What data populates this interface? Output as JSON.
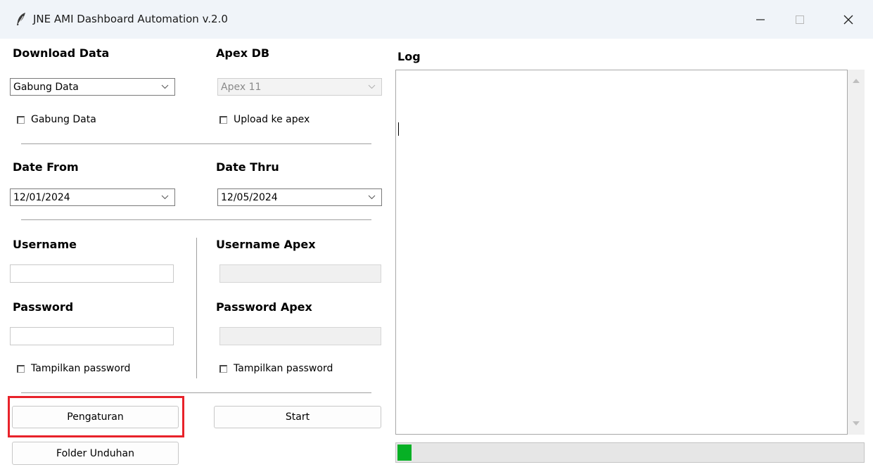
{
  "window": {
    "title": "JNE AMI Dashboard Automation v.2.0",
    "app_icon": "feather-icon",
    "controls": [
      "minimize-icon",
      "maximize-icon",
      "close-icon"
    ]
  },
  "download": {
    "label": "Download Data",
    "selected": "Gabung Data",
    "checkbox_label": "Gabung Data",
    "checked": false
  },
  "apex": {
    "label": "Apex DB",
    "selected": "Apex 11",
    "enabled": false,
    "checkbox_label": "Upload ke apex",
    "checked": false
  },
  "dates": {
    "from_label": "Date From",
    "from_value": "12/01/2024",
    "thru_label": "Date Thru",
    "thru_value": "12/05/2024"
  },
  "credentials": {
    "username_label": "Username",
    "username_value": "",
    "password_label": "Password",
    "password_value": "",
    "show_password_label": "Tampilkan password",
    "username_apex_label": "Username Apex",
    "password_apex_label": "Password Apex",
    "show_password_apex_label": "Tampilkan password"
  },
  "buttons": {
    "settings": "Pengaturan",
    "start": "Start",
    "download_folder": "Folder Unduhan"
  },
  "log": {
    "label": "Log",
    "content": ""
  },
  "progress": {
    "fraction": 0.03
  },
  "colors": {
    "titlebar": "#f0f4f9",
    "highlight": "#e8222a",
    "progress_fill": "#06b025"
  }
}
